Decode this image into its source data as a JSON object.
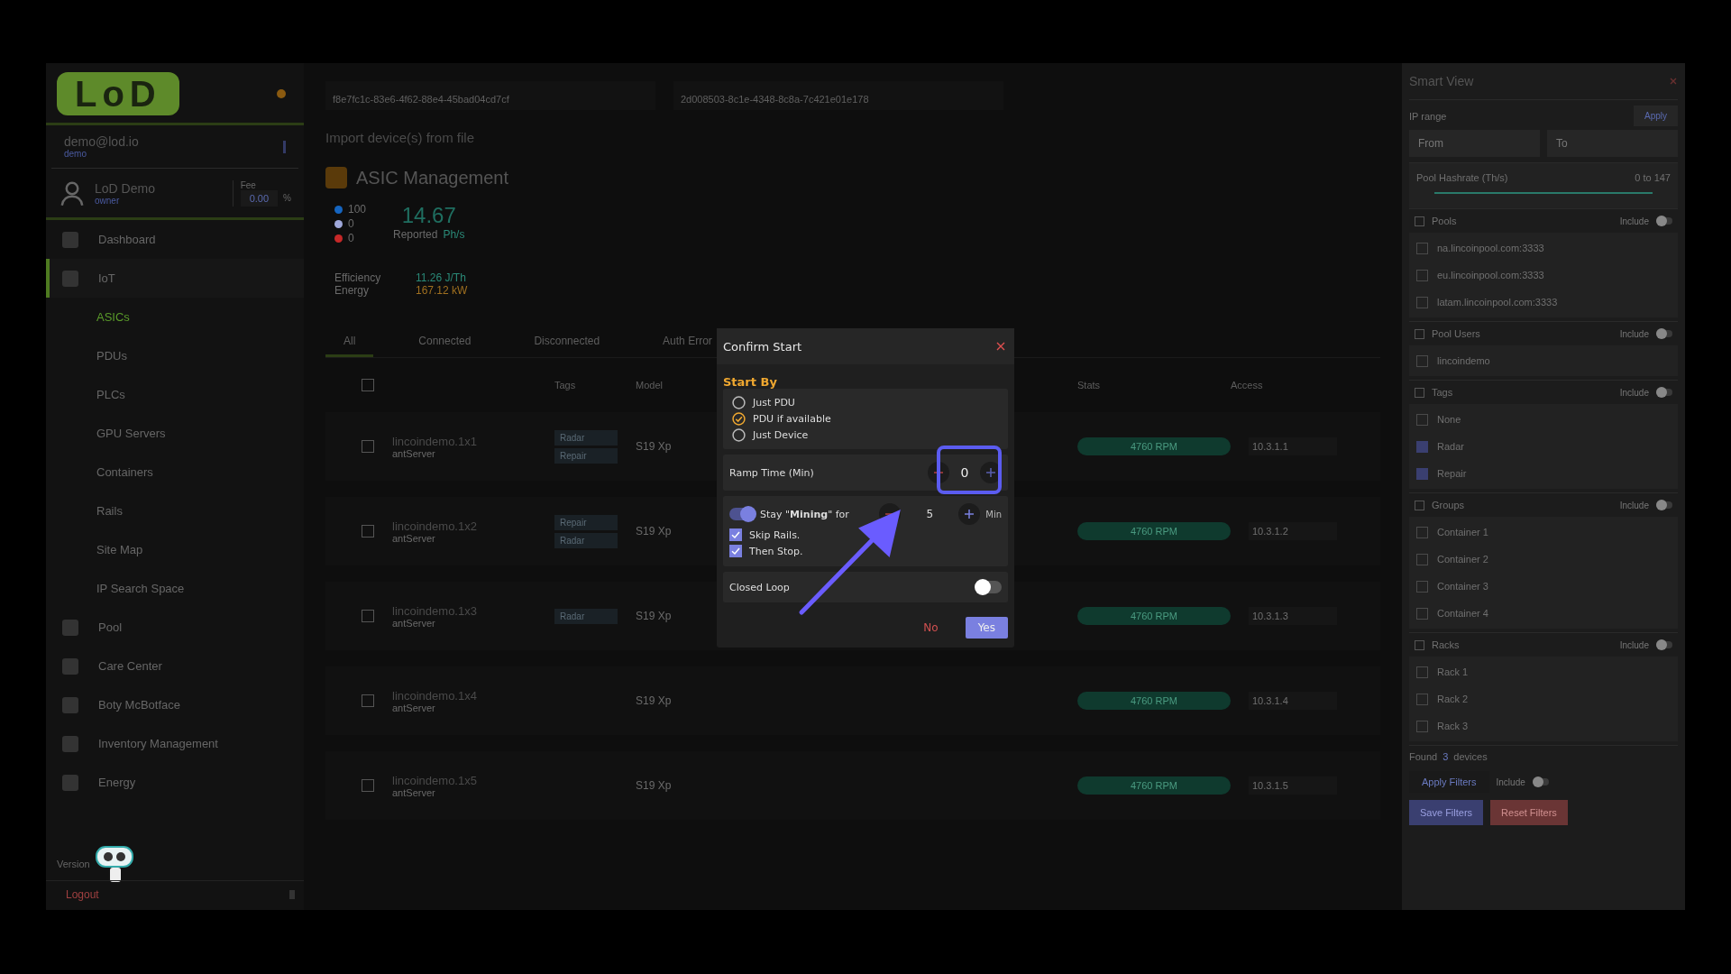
{
  "sidebar": {
    "logo": "LoD",
    "account": {
      "email": "demo@lod.io",
      "role": "demo"
    },
    "user": {
      "name": "LoD Demo",
      "role": "owner",
      "fee_label": "Fee",
      "fee": "0.00",
      "fee_unit": "%"
    },
    "items": [
      {
        "label": "Dashboard",
        "selected": false
      },
      {
        "label": "IoT",
        "selected": true,
        "children": [
          {
            "label": "ASICs",
            "selected": true
          },
          {
            "label": "PDUs",
            "selected": false
          },
          {
            "label": "PLCs",
            "selected": false
          },
          {
            "label": "GPU Servers",
            "selected": false
          },
          {
            "label": "Containers",
            "selected": false
          },
          {
            "label": "Rails",
            "selected": false
          },
          {
            "label": "Site Map",
            "selected": false
          },
          {
            "label": "IP Search Space",
            "selected": false
          }
        ]
      },
      {
        "label": "Pool",
        "selected": false
      },
      {
        "label": "Care Center",
        "selected": false
      },
      {
        "label": "Boty McBotface",
        "selected": false
      },
      {
        "label": "Inventory Management",
        "selected": false
      },
      {
        "label": "Energy",
        "selected": false
      }
    ],
    "version_label": "Version",
    "logout": "Logout"
  },
  "main": {
    "keys": [
      "f8e7fc1c-83e6-4f62-88e4-45bad04cd7cf",
      "2d008503-8c1e-4348-8c8a-7c421e01e178"
    ],
    "import_title": "Import device(s) from file",
    "title": "ASIC Management",
    "summary": {
      "counts": [
        {
          "value": "100",
          "color": "#1565c0"
        },
        {
          "value": "0",
          "color": "#9fa8da"
        },
        {
          "value": "0",
          "color": "#c62828"
        }
      ],
      "hashrate": "14.67",
      "hashrate_label": "Reported",
      "hashrate_unit": "Ph/s",
      "efficiency_label": "Efficiency",
      "efficiency": "11.26 J/Th",
      "energy_label": "Energy",
      "energy": "167.12 kW"
    },
    "tabs": [
      {
        "label": "All",
        "selected": true
      },
      {
        "label": "Connected",
        "selected": false
      },
      {
        "label": "Disconnected",
        "selected": false
      },
      {
        "label": "Auth Error",
        "selected": false
      }
    ],
    "columns": [
      "Tags",
      "Model",
      "Stats",
      "Access"
    ],
    "select_all_checked": false,
    "rows": [
      {
        "name": "lincoindemo.1x1",
        "sub": "antServer",
        "checked": false,
        "tags": [
          "Radar",
          "Repair"
        ],
        "model": "S19 Xp",
        "rpm": "4760 RPM",
        "ip": "10.3.1.1"
      },
      {
        "name": "lincoindemo.1x2",
        "sub": "antServer",
        "checked": false,
        "tags": [
          "Repair",
          "Radar"
        ],
        "model": "S19 Xp",
        "rpm": "4760 RPM",
        "ip": "10.3.1.2"
      },
      {
        "name": "lincoindemo.1x3",
        "sub": "antServer",
        "checked": false,
        "tags": [
          "Radar"
        ],
        "model": "S19 Xp",
        "rpm": "4760 RPM",
        "ip": "10.3.1.3"
      },
      {
        "name": "lincoindemo.1x4",
        "sub": "antServer",
        "checked": false,
        "model": "S19 Xp",
        "rpm": "4760 RPM",
        "ip": "10.3.1.4"
      },
      {
        "name": "lincoindemo.1x5",
        "sub": "antServer",
        "checked": false,
        "model": "S19 Xp",
        "rpm": "4760 RPM",
        "ip": "10.3.1.5"
      }
    ]
  },
  "smart_view": {
    "title": "Smart View",
    "ip_label": "IP range",
    "apply": "Apply",
    "from_placeholder": "From",
    "to_placeholder": "To",
    "hashrate_label": "Pool Hashrate (Th/s)",
    "hashrate_range": "0 to 147",
    "hashrate_slider": {
      "level": 1
    },
    "sections": [
      {
        "title": "Pools",
        "include": "Include",
        "include_on": false,
        "all_checked": false,
        "items": [
          {
            "label": "na.lincoinpool.com:3333",
            "checked": false
          },
          {
            "label": "eu.lincoinpool.com:3333",
            "checked": false
          },
          {
            "label": "latam.lincoinpool.com:3333",
            "checked": false
          }
        ]
      },
      {
        "title": "Pool Users",
        "include": "Include",
        "include_on": false,
        "all_checked": false,
        "items": [
          {
            "label": "lincoindemo",
            "checked": false
          }
        ]
      },
      {
        "title": "Tags",
        "include": "Include",
        "include_on": false,
        "all_checked": false,
        "items": [
          {
            "label": "None",
            "checked": false
          },
          {
            "label": "Radar",
            "checked": true
          },
          {
            "label": "Repair",
            "checked": true
          }
        ]
      },
      {
        "title": "Groups",
        "include": "Include",
        "include_on": false,
        "all_checked": false,
        "items": [
          {
            "label": "Container 1",
            "checked": false
          },
          {
            "label": "Container 2",
            "checked": false
          },
          {
            "label": "Container 3",
            "checked": false
          },
          {
            "label": "Container 4",
            "checked": false
          }
        ]
      },
      {
        "title": "Racks",
        "include": "Include",
        "include_on": false,
        "all_checked": false,
        "items": [
          {
            "label": "Rack 1",
            "checked": false
          },
          {
            "label": "Rack 2",
            "checked": false
          },
          {
            "label": "Rack 3",
            "checked": false
          }
        ]
      }
    ],
    "found": "Found",
    "found_count": "3",
    "found_unit": "devices",
    "apply_filters": "Apply Filters",
    "include": "Include",
    "include_on": false,
    "save": "Save Filters",
    "reset": "Reset Filters"
  },
  "dialog": {
    "title": "Confirm Start",
    "start_by_label": "Start By",
    "options": [
      {
        "label": "Just PDU",
        "selected": false
      },
      {
        "label": "PDU if available",
        "selected": true
      },
      {
        "label": "Just Device",
        "selected": false
      }
    ],
    "ramp_label": "Ramp Time (Min)",
    "ramp_value": "0",
    "stay": {
      "on": true,
      "label": "Stay \"**Mining**\" for",
      "value": "5",
      "unit": "Min"
    },
    "checks": [
      {
        "label": "Skip Rails.",
        "checked": true
      },
      {
        "label": "Then Stop.",
        "checked": true
      }
    ],
    "closed_loop": {
      "label": "Closed Loop",
      "on": false
    },
    "no": "No",
    "yes": "Yes"
  }
}
